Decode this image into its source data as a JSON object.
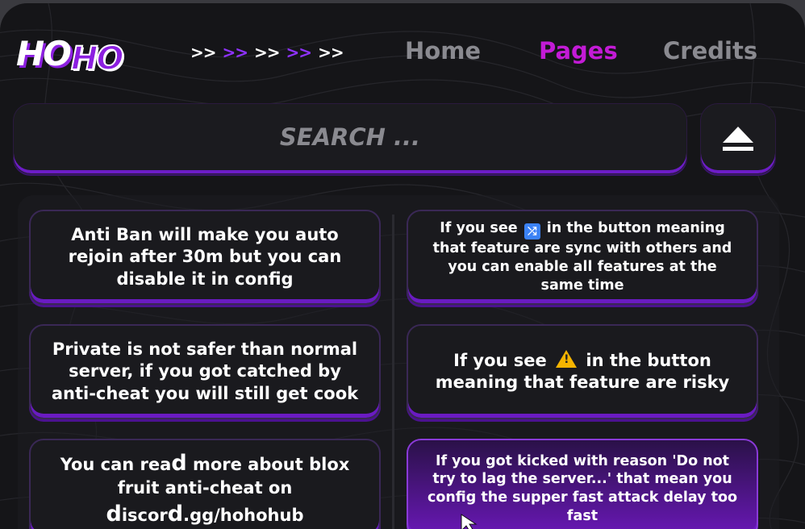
{
  "logo": {
    "part1": "HO",
    "part2": "HO"
  },
  "breadcrumb_arrows": [
    {
      "text": ">>",
      "color": "#ffffff"
    },
    {
      "text": ">>",
      "color": "#8f32ff"
    },
    {
      "text": ">>",
      "color": "#ffffff"
    },
    {
      "text": ">>",
      "color": "#8f32ff"
    },
    {
      "text": ">>",
      "color": "#ffffff"
    }
  ],
  "nav": {
    "home": "Home",
    "pages": "Pages",
    "credits": "Credits",
    "active": "Pages"
  },
  "search": {
    "placeholder": "SEARCH ..."
  },
  "eject_button": {
    "icon": "eject-icon"
  },
  "cards_left": [
    {
      "text": "Anti Ban will make you auto rejoin after 30m but you can disable it in config"
    },
    {
      "text": "Private is not safer than normal server, if you got catched by anti-cheat you will still get cook"
    },
    {
      "line1_pre": "You can rea",
      "line1_big": "d",
      "line1_post": " more about blox fruit anti-cheat on",
      "line2_big1": "d",
      "line2_mid": "iscor",
      "line2_big2": "d",
      "line2_post": ".gg/hohohub"
    }
  ],
  "cards_right": [
    {
      "pre": "If you see",
      "icon": "shuffle-icon",
      "post": "in the button meaning that feature are sync with others and you can enable all features at the same time"
    },
    {
      "pre": "If you see",
      "icon": "warning-icon",
      "post": "in the button meaning that feature are risky"
    },
    {
      "text": "If you got kicked with reason 'Do not try to lag the server...' that mean you config the supper fast attack delay too fast"
    }
  ],
  "colors": {
    "accent": "#8c1fe0",
    "nav_active": "#c31bd6",
    "nav_inactive": "#8a8a90",
    "background": "#151518"
  }
}
